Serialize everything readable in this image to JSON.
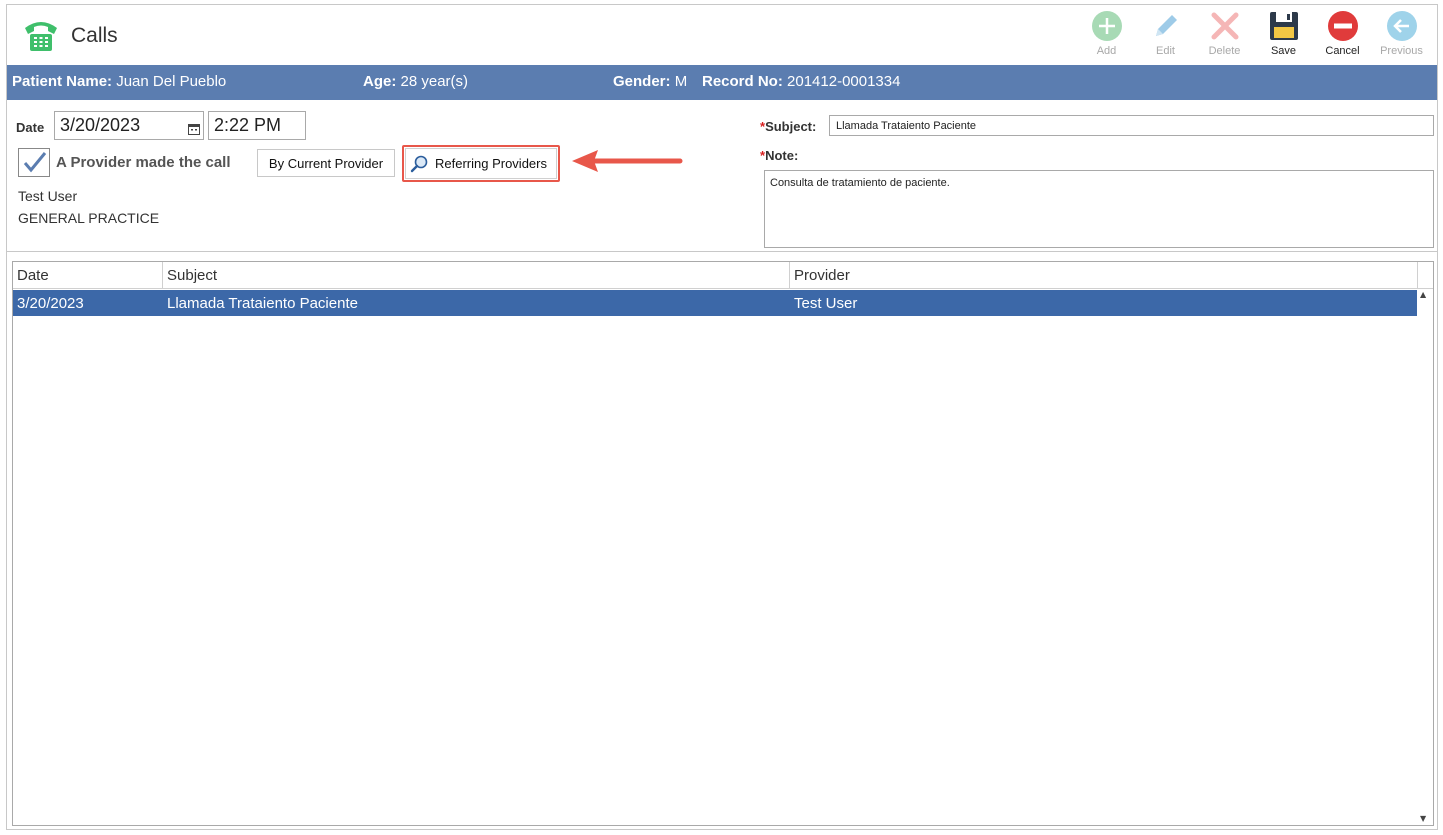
{
  "app": {
    "title": "Calls",
    "icon": "phone-icon"
  },
  "toolbar": {
    "add": {
      "label": "Add",
      "enabled": false,
      "icon": "add-icon",
      "color": "#a8dab5"
    },
    "edit": {
      "label": "Edit",
      "enabled": false,
      "icon": "pencil-icon",
      "color": "#9ecbe8"
    },
    "delete": {
      "label": "Delete",
      "enabled": false,
      "icon": "delete-icon",
      "color": "#f5b6b6"
    },
    "save": {
      "label": "Save",
      "enabled": true,
      "icon": "floppy-disk-icon",
      "color": "#2d3a4a"
    },
    "cancel": {
      "label": "Cancel",
      "enabled": true,
      "icon": "cancel-icon",
      "color": "#e03b3b"
    },
    "previous": {
      "label": "Previous",
      "enabled": false,
      "icon": "arrow-left-icon",
      "color": "#9fd3ea"
    }
  },
  "patient": {
    "name_label": "Patient Name:",
    "name": "Juan Del Pueblo",
    "age_label": "Age:",
    "age": "28 year(s)",
    "gender_label": "Gender:",
    "gender": "M",
    "record_label": "Record No:",
    "record": "201412-0001334"
  },
  "form": {
    "date_label": "Date",
    "date_value": "3/20/2023",
    "time_value": "2:22 PM",
    "provider_checkbox_label": "A Provider made the call",
    "provider_checked": true,
    "by_current_provider_label": "By Current Provider",
    "referring_providers_label": "Referring Providers",
    "provider_name": "Test User",
    "provider_specialty": "GENERAL PRACTICE",
    "subject_label": "Subject:",
    "subject_value": "Llamada Trataiento Paciente",
    "note_label": "Note:",
    "note_value": "Consulta de tratamiento de paciente."
  },
  "grid": {
    "columns": [
      "Date",
      "Subject",
      "Provider"
    ],
    "rows": [
      {
        "date": "3/20/2023",
        "subject": "Llamada Trataiento Paciente",
        "provider": "Test User",
        "selected": true
      }
    ]
  },
  "colors": {
    "band": "#5b7db0",
    "selected_row": "#3c68a8",
    "highlight": "#e8574a"
  }
}
